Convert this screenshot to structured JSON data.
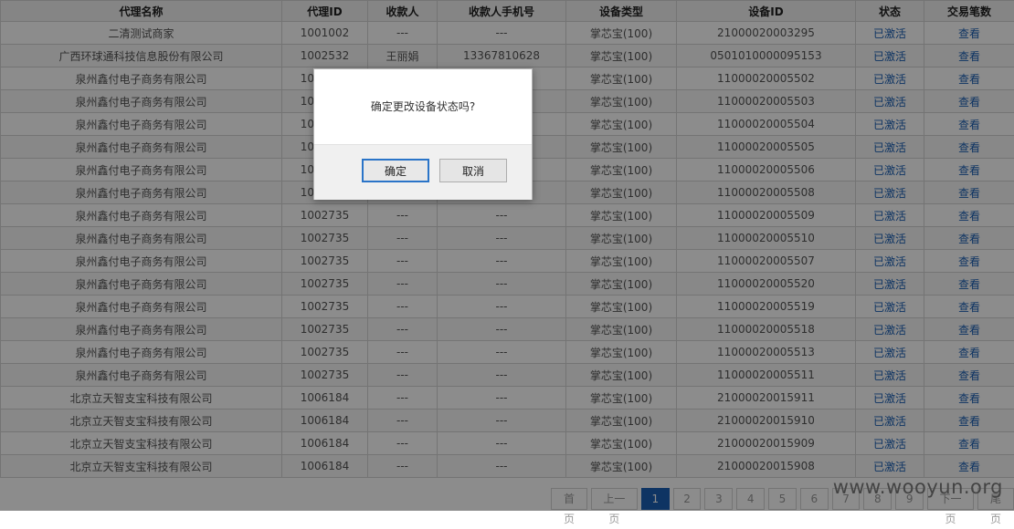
{
  "table": {
    "headers": [
      "代理名称",
      "代理ID",
      "收款人",
      "收款人手机号",
      "设备类型",
      "设备ID",
      "状态",
      "交易笔数"
    ],
    "rows": [
      [
        "二清测试商家",
        "1001002",
        "---",
        "---",
        "掌芯宝(100)",
        "21000020003295",
        "已激活",
        "查看"
      ],
      [
        "广西环球通科技信息股份有限公司",
        "1002532",
        "王丽娟",
        "13367810628",
        "掌芯宝(100)",
        "0501010000095153",
        "已激活",
        "查看"
      ],
      [
        "泉州鑫付电子商务有限公司",
        "1002735",
        "---",
        "---",
        "掌芯宝(100)",
        "11000020005502",
        "已激活",
        "查看"
      ],
      [
        "泉州鑫付电子商务有限公司",
        "1002735",
        "---",
        "---",
        "掌芯宝(100)",
        "11000020005503",
        "已激活",
        "查看"
      ],
      [
        "泉州鑫付电子商务有限公司",
        "1002735",
        "---",
        "---",
        "掌芯宝(100)",
        "11000020005504",
        "已激活",
        "查看"
      ],
      [
        "泉州鑫付电子商务有限公司",
        "1002735",
        "---",
        "---",
        "掌芯宝(100)",
        "11000020005505",
        "已激活",
        "查看"
      ],
      [
        "泉州鑫付电子商务有限公司",
        "1002735",
        "---",
        "",
        "掌芯宝(100)",
        "11000020005506",
        "已激活",
        "查看"
      ],
      [
        "泉州鑫付电子商务有限公司",
        "1002735",
        "---",
        "---",
        "掌芯宝(100)",
        "11000020005508",
        "已激活",
        "查看"
      ],
      [
        "泉州鑫付电子商务有限公司",
        "1002735",
        "---",
        "---",
        "掌芯宝(100)",
        "11000020005509",
        "已激活",
        "查看"
      ],
      [
        "泉州鑫付电子商务有限公司",
        "1002735",
        "---",
        "---",
        "掌芯宝(100)",
        "11000020005510",
        "已激活",
        "查看"
      ],
      [
        "泉州鑫付电子商务有限公司",
        "1002735",
        "---",
        "---",
        "掌芯宝(100)",
        "11000020005507",
        "已激活",
        "查看"
      ],
      [
        "泉州鑫付电子商务有限公司",
        "1002735",
        "---",
        "---",
        "掌芯宝(100)",
        "11000020005520",
        "已激活",
        "查看"
      ],
      [
        "泉州鑫付电子商务有限公司",
        "1002735",
        "---",
        "---",
        "掌芯宝(100)",
        "11000020005519",
        "已激活",
        "查看"
      ],
      [
        "泉州鑫付电子商务有限公司",
        "1002735",
        "---",
        "---",
        "掌芯宝(100)",
        "11000020005518",
        "已激活",
        "查看"
      ],
      [
        "泉州鑫付电子商务有限公司",
        "1002735",
        "---",
        "---",
        "掌芯宝(100)",
        "11000020005513",
        "已激活",
        "查看"
      ],
      [
        "泉州鑫付电子商务有限公司",
        "1002735",
        "---",
        "---",
        "掌芯宝(100)",
        "11000020005511",
        "已激活",
        "查看"
      ],
      [
        "北京立天智支宝科技有限公司",
        "1006184",
        "---",
        "---",
        "掌芯宝(100)",
        "21000020015911",
        "已激活",
        "查看"
      ],
      [
        "北京立天智支宝科技有限公司",
        "1006184",
        "---",
        "---",
        "掌芯宝(100)",
        "21000020015910",
        "已激活",
        "查看"
      ],
      [
        "北京立天智支宝科技有限公司",
        "1006184",
        "---",
        "---",
        "掌芯宝(100)",
        "21000020015909",
        "已激活",
        "查看"
      ],
      [
        "北京立天智支宝科技有限公司",
        "1006184",
        "---",
        "---",
        "掌芯宝(100)",
        "21000020015908",
        "已激活",
        "查看"
      ]
    ]
  },
  "pager": {
    "first": "首页",
    "prev": "上一页",
    "pages": [
      "1",
      "2",
      "3",
      "4",
      "5",
      "6",
      "7",
      "8",
      "9"
    ],
    "current": "1",
    "next": "下一页",
    "last": "尾页"
  },
  "dialog": {
    "message": "确定更改设备状态吗?",
    "ok_label": "确定",
    "cancel_label": "取消"
  },
  "watermark": "www.wooyun.org",
  "colors": {
    "link": "#1a5fb4",
    "overlay": "rgba(0,0,0,0.45)",
    "dialog_ok_border": "#2a74c8"
  }
}
